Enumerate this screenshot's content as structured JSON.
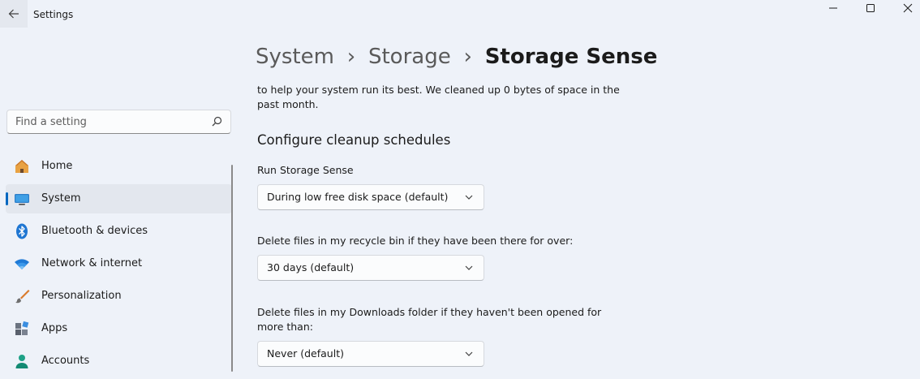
{
  "window": {
    "title": "Settings",
    "minimize_label": "Minimize",
    "maximize_label": "Maximize",
    "close_label": "Close"
  },
  "search": {
    "placeholder": "Find a setting",
    "value": ""
  },
  "sidebar": {
    "items": [
      {
        "label": "Home",
        "icon": "home-icon",
        "selected": false
      },
      {
        "label": "System",
        "icon": "system-monitor-icon",
        "selected": true
      },
      {
        "label": "Bluetooth & devices",
        "icon": "bluetooth-icon",
        "selected": false
      },
      {
        "label": "Network & internet",
        "icon": "wifi-icon",
        "selected": false
      },
      {
        "label": "Personalization",
        "icon": "paintbrush-icon",
        "selected": false
      },
      {
        "label": "Apps",
        "icon": "apps-icon",
        "selected": false
      },
      {
        "label": "Accounts",
        "icon": "person-icon",
        "selected": false
      }
    ]
  },
  "breadcrumb": {
    "items": [
      "System",
      "Storage",
      "Storage Sense"
    ],
    "separator": "›"
  },
  "content": {
    "description": "to help your system run its best. We cleaned up 0 bytes of space in the past month.",
    "section_title": "Configure cleanup schedules",
    "run_label": "Run Storage Sense",
    "run_value": "During low free disk space (default)",
    "recycle_label": "Delete files in my recycle bin if they have been there for over:",
    "recycle_value": "30 days (default)",
    "downloads_label": "Delete files in my Downloads folder if they haven't been opened for more than:",
    "downloads_value": "Never (default)"
  },
  "colors": {
    "accent": "#0067c0",
    "background": "#eef2f9",
    "selected_item": "#e3e7ee"
  }
}
